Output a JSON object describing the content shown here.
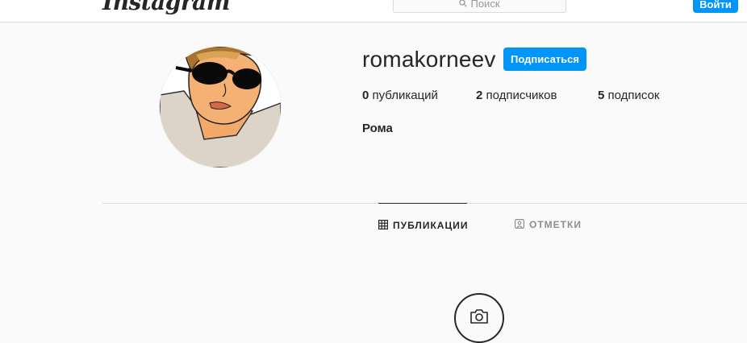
{
  "header": {
    "logo_text": "Instagram",
    "search": {
      "placeholder": "Поиск",
      "icon": "search-icon"
    },
    "login_label": "Войти"
  },
  "profile": {
    "username": "romakorneev",
    "follow_label": "Подписаться",
    "stats": [
      {
        "count": "0",
        "label": "публикаций"
      },
      {
        "count": "2",
        "label": "подписчиков"
      },
      {
        "count": "5",
        "label": "подписок"
      }
    ],
    "full_name": "Рома"
  },
  "tabs": [
    {
      "label": "ПУБЛИКАЦИИ",
      "icon": "grid-icon",
      "active": true
    },
    {
      "label": "ОТМЕТКИ",
      "icon": "tagged-user-icon",
      "active": false
    }
  ],
  "empty_state": {
    "icon": "camera-icon"
  },
  "colors": {
    "accent": "#0095f6",
    "text": "#262626",
    "muted": "#8e8e8e",
    "border": "#dbdbdb",
    "background": "#fafafa"
  }
}
